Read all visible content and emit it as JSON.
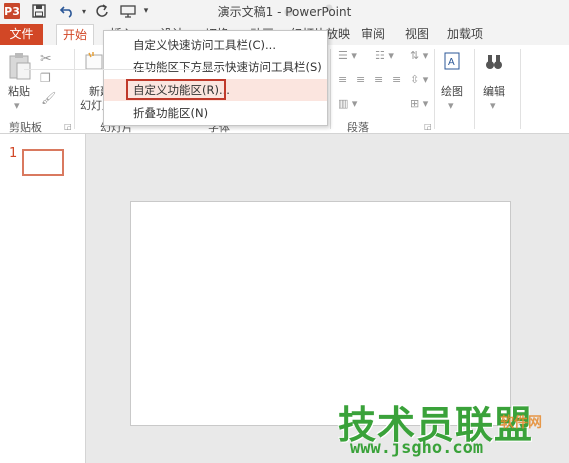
{
  "titlebar": {
    "app_icon": "P3",
    "title": "演示文稿1 - PowerPoint",
    "quick_access": [
      "save-icon",
      "undo-icon",
      "redo-icon",
      "slideshow-icon",
      "customize-dropdown-icon"
    ]
  },
  "tabs": [
    {
      "label": "文件"
    },
    {
      "label": "开始"
    },
    {
      "label": "插入"
    },
    {
      "label": "设计"
    },
    {
      "label": "切换"
    },
    {
      "label": "动画"
    },
    {
      "label": "幻灯片放映"
    },
    {
      "label": "审阅"
    },
    {
      "label": "视图"
    },
    {
      "label": "加载项"
    }
  ],
  "ribbon": {
    "paste_label": "粘贴",
    "clipboard_group": "剪贴板",
    "new_slide_label_1": "新建",
    "new_slide_label_2": "幻灯片",
    "slides_group": "幻灯片",
    "font_group": "字体",
    "paragraph_group": "段落",
    "drawing_label": "绘图",
    "editing_label": "编辑"
  },
  "dropdown_menu": {
    "items": [
      {
        "label": "自定义快速访问工具栏(C)..."
      },
      {
        "label": "在功能区下方显示快速访问工具栏(S)"
      },
      {
        "label": "自定义功能区(R)..."
      },
      {
        "label": "折叠功能区(N)"
      }
    ]
  },
  "slide_pane": {
    "slide_number": "1"
  },
  "watermark": {
    "main": "技术员联盟",
    "url": "www.jsgho.com",
    "side": "软件网"
  },
  "colors": {
    "accent": "#d24726",
    "menu_highlight": "#fbe5df",
    "highlight_border": "#c0392b",
    "watermark": "#3aa23a"
  }
}
